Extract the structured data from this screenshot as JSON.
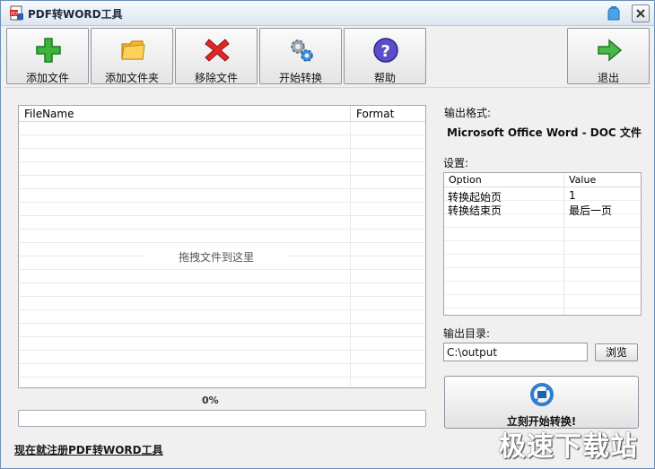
{
  "window": {
    "title": "PDF转WORD工具"
  },
  "toolbar": [
    {
      "label": "添加文件",
      "icon": "add-plus-icon"
    },
    {
      "label": "添加文件夹",
      "icon": "folder-icon"
    },
    {
      "label": "移除文件",
      "icon": "remove-x-icon"
    },
    {
      "label": "开始转换",
      "icon": "gears-icon"
    },
    {
      "label": "帮助",
      "icon": "help-icon"
    },
    {
      "label": "退出",
      "icon": "exit-arrow-icon"
    }
  ],
  "file_list": {
    "columns": [
      "FileName",
      "Format"
    ],
    "drop_hint": "拖拽文件到这里"
  },
  "progress": {
    "percent_text": "0%",
    "value": 0
  },
  "register_link": "现在就注册PDF转WORD工具",
  "output_format": {
    "label": "输出格式:",
    "value": "Microsoft Office Word - DOC 文件"
  },
  "settings": {
    "label": "设置:",
    "columns": [
      "Option",
      "Value"
    ],
    "rows": [
      {
        "option": "转换起始页",
        "value": "1"
      },
      {
        "option": "转换结束页",
        "value": "最后一页"
      }
    ]
  },
  "output_dir": {
    "label": "输出目录:",
    "value": "C:\\output",
    "browse_label": "浏览"
  },
  "start_button": {
    "label": "立刻开始转换!"
  },
  "watermark": "极速下载站",
  "colors": {
    "accent": "#3a78c8",
    "title_bar": "#dde6f1"
  }
}
